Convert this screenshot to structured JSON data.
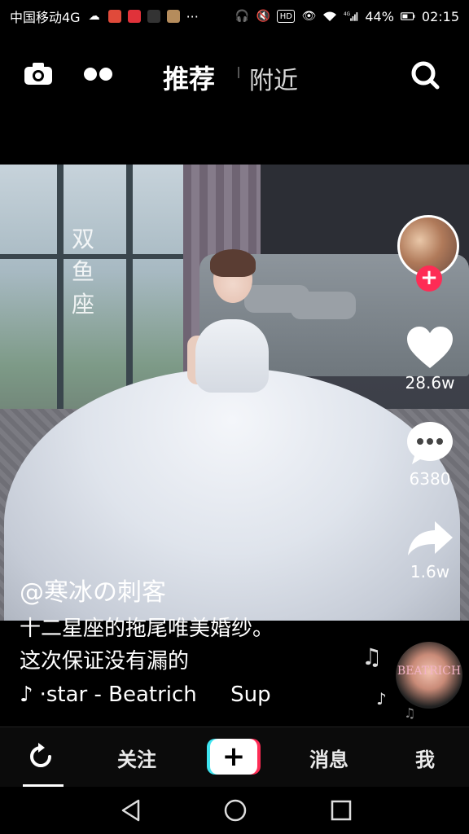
{
  "status_bar": {
    "carrier": "中国移动4G",
    "battery": "44%",
    "time": "02:15",
    "network": "4G",
    "more": "···",
    "colors": {
      "app1": "#e04a3a",
      "app2": "#e0323a",
      "app3": "#333333",
      "app4": "#b58c5c"
    }
  },
  "top_nav": {
    "tabs": [
      "推荐",
      "附近"
    ],
    "active_tab": "推荐",
    "icons": [
      "camera-icon",
      "dots-icon",
      "search-icon"
    ]
  },
  "video": {
    "overlay_text": "双鱼座"
  },
  "actions": {
    "likes": "28.6w",
    "comments": "6380",
    "shares": "1.6w"
  },
  "caption": {
    "author": "@寒冰の刺客",
    "line1": "十二星座的拖尾唯美婚纱。",
    "line2": "这次保证没有漏的",
    "music": "·star - Beatrich     Sup"
  },
  "music_disc": {
    "label": "BEATRICH"
  },
  "bottom_nav": {
    "items": [
      "关注",
      "消息",
      "我"
    ],
    "plus": "+"
  },
  "accent": {
    "pink": "#fe2c55",
    "cyan": "#3fe4f0"
  }
}
